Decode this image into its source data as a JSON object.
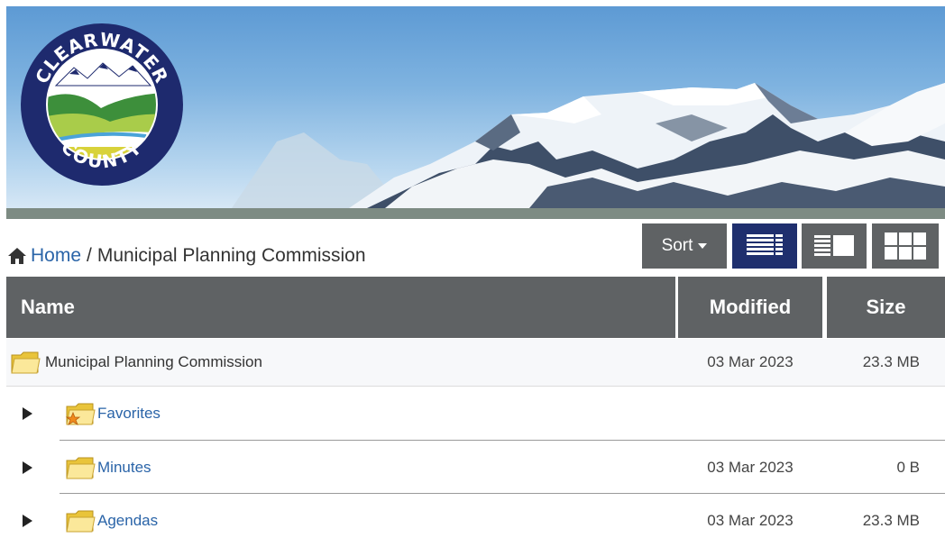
{
  "logo": {
    "top_text": "CLEARWATER",
    "bottom_text": "COUNTY",
    "icon": "clearwater-county-logo"
  },
  "breadcrumb": {
    "home_icon": "home-icon",
    "home_label": "Home",
    "separator": "/",
    "current": "Municipal Planning Commission"
  },
  "toolbar": {
    "sort_label": "Sort",
    "views": [
      {
        "name": "list-view",
        "icon": "list-view-icon",
        "active": true
      },
      {
        "name": "detail-view",
        "icon": "detail-view-icon",
        "active": false
      },
      {
        "name": "grid-view",
        "icon": "grid-view-icon",
        "active": false
      }
    ]
  },
  "table": {
    "columns": [
      "Name",
      "Modified",
      "Size"
    ],
    "root": {
      "name": "Municipal Planning Commission",
      "modified": "03 Mar 2023",
      "size": "23.3 MB",
      "icon": "folder-icon"
    },
    "children": [
      {
        "name": "Favorites",
        "modified": "",
        "size": "",
        "icon": "favorites-folder-icon"
      },
      {
        "name": "Minutes",
        "modified": "03 Mar 2023",
        "size": "0 B",
        "icon": "folder-icon"
      },
      {
        "name": "Agendas",
        "modified": "03 Mar 2023",
        "size": "23.3 MB",
        "icon": "folder-icon"
      }
    ]
  },
  "colors": {
    "header_bg": "#5f6264",
    "active_view": "#1f2f6e",
    "link": "#2a64a8",
    "logo_ring": "#1e2a6e"
  }
}
